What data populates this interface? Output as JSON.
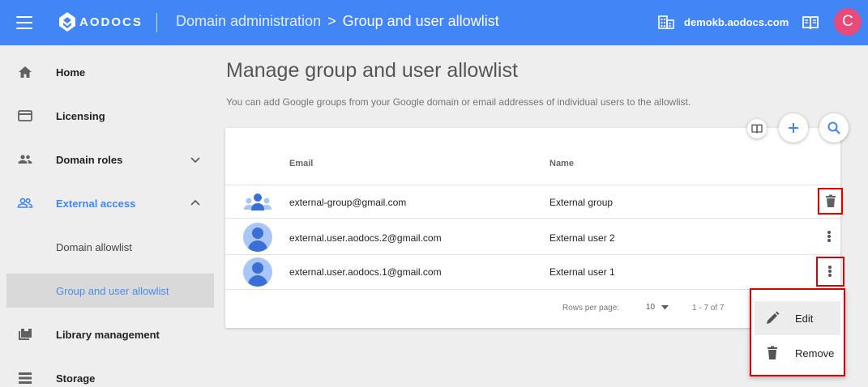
{
  "app": {
    "logo_text": "AODOCS",
    "breadcrumb_parent": "Domain administration",
    "breadcrumb_separator": ">",
    "breadcrumb_current": "Group and user allowlist",
    "domain": "demokb.aodocs.com",
    "user_initial": "C",
    "colors": {
      "topbar": "#4285f4",
      "avatar": "#e84a7a",
      "highlight": "#e00000",
      "accent": "#4285f4"
    }
  },
  "sidebar": {
    "items": [
      {
        "label": "Home",
        "icon": "home-icon"
      },
      {
        "label": "Licensing",
        "icon": "credit-card-icon"
      },
      {
        "label": "Domain roles",
        "icon": "people-icon"
      },
      {
        "label": "External access",
        "icon": "people-outline-icon"
      },
      {
        "label": "Domain allowlist"
      },
      {
        "label": "Group and user allowlist"
      },
      {
        "label": "Library management",
        "icon": "library-icon"
      },
      {
        "label": "Storage",
        "icon": "storage-icon"
      }
    ]
  },
  "main": {
    "title": "Manage group and user allowlist",
    "description": "You can add Google groups from your Google domain or email addresses of individual users to the allowlist.",
    "table": {
      "headers": {
        "email": "Email",
        "name": "Name"
      },
      "rows": [
        {
          "email": "external-group@gmail.com",
          "name": "External group",
          "type": "group"
        },
        {
          "email": "external.user.aodocs.2@gmail.com",
          "name": "External user 2",
          "type": "user"
        },
        {
          "email": "external.user.aodocs.1@gmail.com",
          "name": "External user 1",
          "type": "user"
        }
      ]
    },
    "pagination": {
      "rows_per_page_label": "Rows per page:",
      "rows_per_page_value": "10",
      "range": "1 - 7 of 7"
    }
  },
  "context_menu": {
    "items": [
      {
        "label": "Edit",
        "icon": "pencil-icon"
      },
      {
        "label": "Remove",
        "icon": "trash-icon"
      }
    ]
  }
}
